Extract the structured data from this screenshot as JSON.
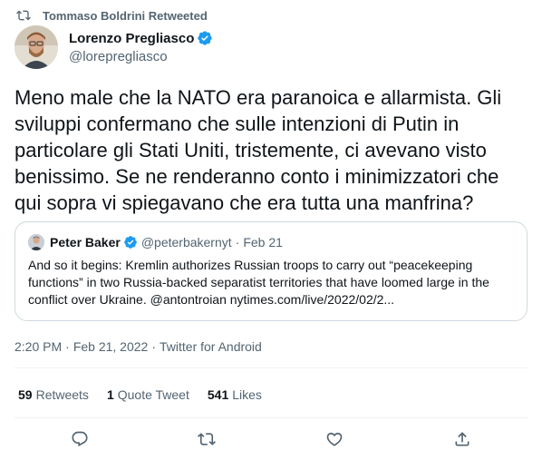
{
  "retweet": {
    "icon": "retweet-icon",
    "text": "Tommaso Boldrini Retweeted"
  },
  "author": {
    "name": "Lorenzo Pregliasco",
    "handle": "@lorepregliasco",
    "verified": true
  },
  "tweet": {
    "text": "Meno male che la NATO era paranoica e allarmista. Gli sviluppi confermano che sulle intenzioni di Putin in particolare gli Stati Uniti, tristemente, ci avevano visto benissimo. Se ne renderanno conto i minimizzatori che qui sopra vi spiegavano che era tutta una manfrina?"
  },
  "quote": {
    "name": "Peter Baker",
    "handle": "@peterbakernyt",
    "separator": "·",
    "date": "Feb 21",
    "text": "And so it begins: Kremlin authorizes Russian troops to carry out “peacekeeping functions” in two Russia-backed separatist territories that have loomed large in the conflict over Ukraine. @antontroian nytimes.com/live/2022/02/2..."
  },
  "meta": {
    "time": "2:20 PM",
    "separator1": "·",
    "date": "Feb 21, 2022",
    "separator2": "·",
    "source": "Twitter for Android"
  },
  "stats": {
    "retweets_count": "59",
    "retweets_label": "Retweets",
    "quotes_count": "1",
    "quotes_label": "Quote Tweet",
    "likes_count": "541",
    "likes_label": "Likes"
  },
  "actions": [
    "reply-icon",
    "retweet-icon",
    "like-icon",
    "share-icon"
  ],
  "colors": {
    "text": "#0f1419",
    "secondary": "#536471",
    "verified": "#1d9bf0",
    "border": "#cfd9de",
    "divider": "#eff3f4"
  }
}
